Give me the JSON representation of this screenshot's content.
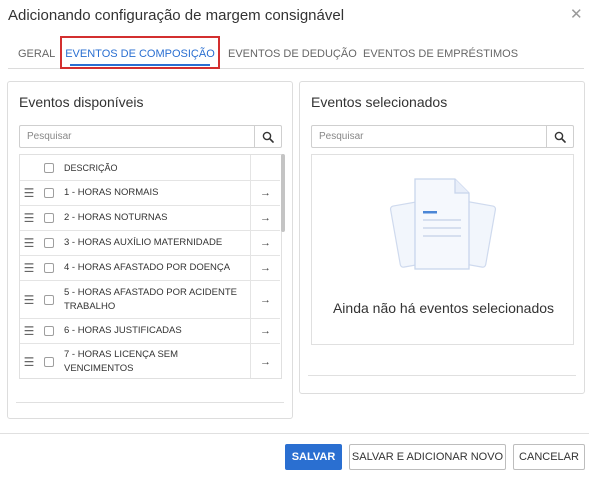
{
  "dialog": {
    "title": "Adicionando configuração de margem consignável",
    "close_icon": "close-icon"
  },
  "tabs": [
    {
      "label": "GERAL",
      "active": false
    },
    {
      "label": "EVENTOS DE COMPOSIÇÃO",
      "active": true
    },
    {
      "label": "EVENTOS DE DEDUÇÃO",
      "active": false
    },
    {
      "label": "EVENTOS DE EMPRÉSTIMOS",
      "active": false
    }
  ],
  "available": {
    "title": "Eventos disponíveis",
    "search_placeholder": "Pesquisar",
    "column_header": "DESCRIÇÃO",
    "items": [
      {
        "label": "1 - HORAS NORMAIS"
      },
      {
        "label": "2 - HORAS NOTURNAS"
      },
      {
        "label": "3 - HORAS AUXÍLIO MATERNIDADE"
      },
      {
        "label": "4 - HORAS AFASTADO POR DOENÇA"
      },
      {
        "label": "5 - HORAS AFASTADO POR ACIDENTE TRABALHO"
      },
      {
        "label": "6 - HORAS JUSTIFICADAS"
      },
      {
        "label": "7 - HORAS LICENÇA SEM VENCIMENTOS"
      }
    ]
  },
  "selected": {
    "title": "Eventos selecionados",
    "search_placeholder": "Pesquisar",
    "empty_message": "Ainda não há eventos selecionados"
  },
  "footer": {
    "save_label": "SALVAR",
    "save_new_label": "SALVAR E ADICIONAR NOVO",
    "cancel_label": "CANCELAR"
  },
  "colors": {
    "accent": "#2a6fd1",
    "highlight_border": "#d32f2f"
  }
}
